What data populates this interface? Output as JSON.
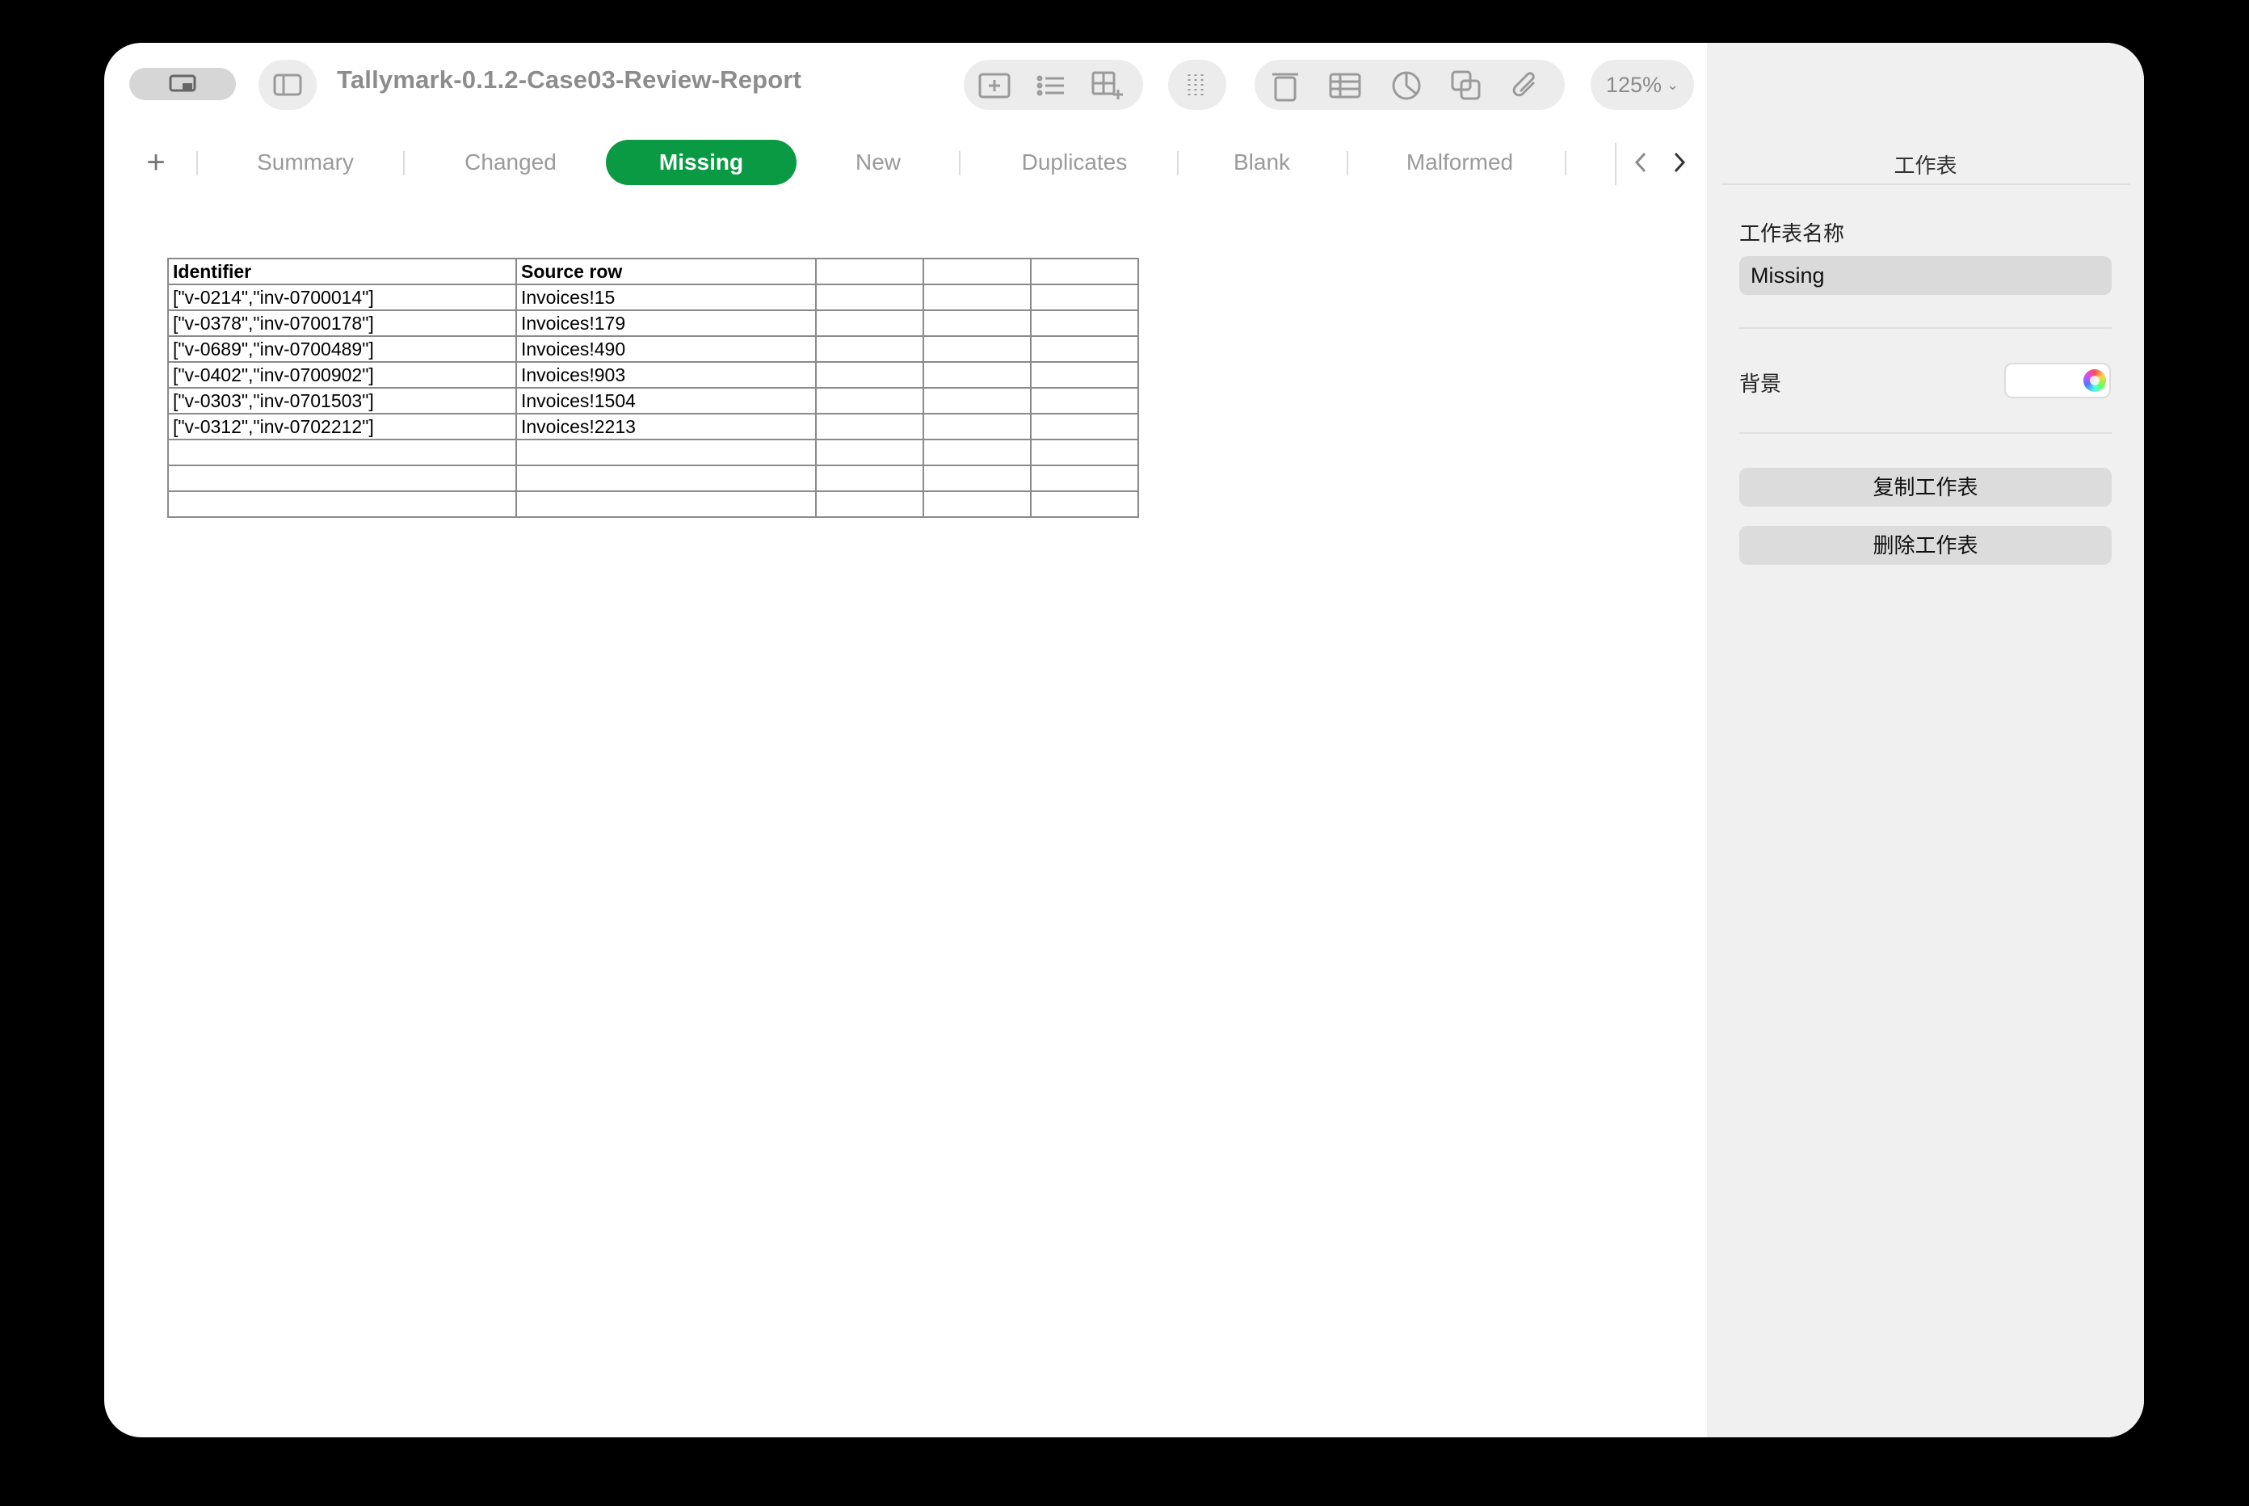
{
  "window": {
    "title": "Tallymark-0.1.2-Case03-Review-Report",
    "zoom": "125%"
  },
  "tabs": {
    "add_label": "+",
    "items": [
      {
        "label": "Summary"
      },
      {
        "label": "Changed"
      },
      {
        "label": "Missing"
      },
      {
        "label": "New"
      },
      {
        "label": "Duplicates"
      },
      {
        "label": "Blank"
      },
      {
        "label": "Malformed"
      }
    ],
    "active": "Missing"
  },
  "sheet": {
    "headers": [
      "Identifier",
      "Source row"
    ],
    "rows": [
      [
        "[\"v-0214\",\"inv-0700014\"]",
        "Invoices!15"
      ],
      [
        "[\"v-0378\",\"inv-0700178\"]",
        "Invoices!179"
      ],
      [
        "[\"v-0689\",\"inv-0700489\"]",
        "Invoices!490"
      ],
      [
        "[\"v-0402\",\"inv-0700902\"]",
        "Invoices!903"
      ],
      [
        "[\"v-0303\",\"inv-0701503\"]",
        "Invoices!1504"
      ],
      [
        "[\"v-0312\",\"inv-0702212\"]",
        "Invoices!2213"
      ]
    ]
  },
  "inspector": {
    "title": "工作表",
    "name_label": "工作表名称",
    "name_value": "Missing",
    "background_label": "背景",
    "duplicate_button": "复制工作表",
    "delete_button": "删除工作表"
  },
  "colors": {
    "accent": "#0a9a44",
    "sidebar_bg": "#f0f0f0"
  }
}
